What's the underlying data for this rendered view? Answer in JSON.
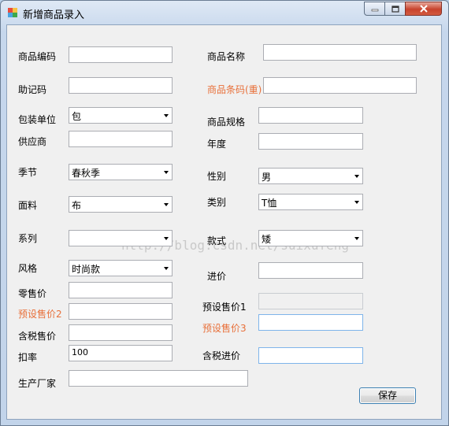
{
  "window": {
    "title": "新增商品录入"
  },
  "labels": {
    "product_code": "商品编码",
    "product_name": "商品名称",
    "mnemonic": "助记码",
    "barcode": "商品条码(重)",
    "pack_unit": "包装单位",
    "spec": "商品规格",
    "supplier": "供应商",
    "year": "年度",
    "season": "季节",
    "gender": "性别",
    "fabric": "面料",
    "category": "类别",
    "series": "系列",
    "style_type": "款式",
    "style": "风格",
    "purchase_price": "进价",
    "retail_price": "零售价",
    "preset_price1": "预设售价1",
    "preset_price2": "预设售价2",
    "preset_price3": "预设售价3",
    "tax_price": "含税售价",
    "discount": "扣率",
    "tax_purchase": "含税进价",
    "manufacturer": "生产厂家"
  },
  "values": {
    "pack_unit": "包",
    "season": "春秋季",
    "gender": "男",
    "fabric": "布",
    "category": "T恤",
    "series": "",
    "style_type": "矮",
    "style": "时尚款",
    "discount": "100"
  },
  "buttons": {
    "save": "保存"
  },
  "watermark": "http://blog.csdn.net/suixufeng",
  "colors": {
    "required_label": "#e8703a",
    "client_bg": "#f0f0f0"
  }
}
